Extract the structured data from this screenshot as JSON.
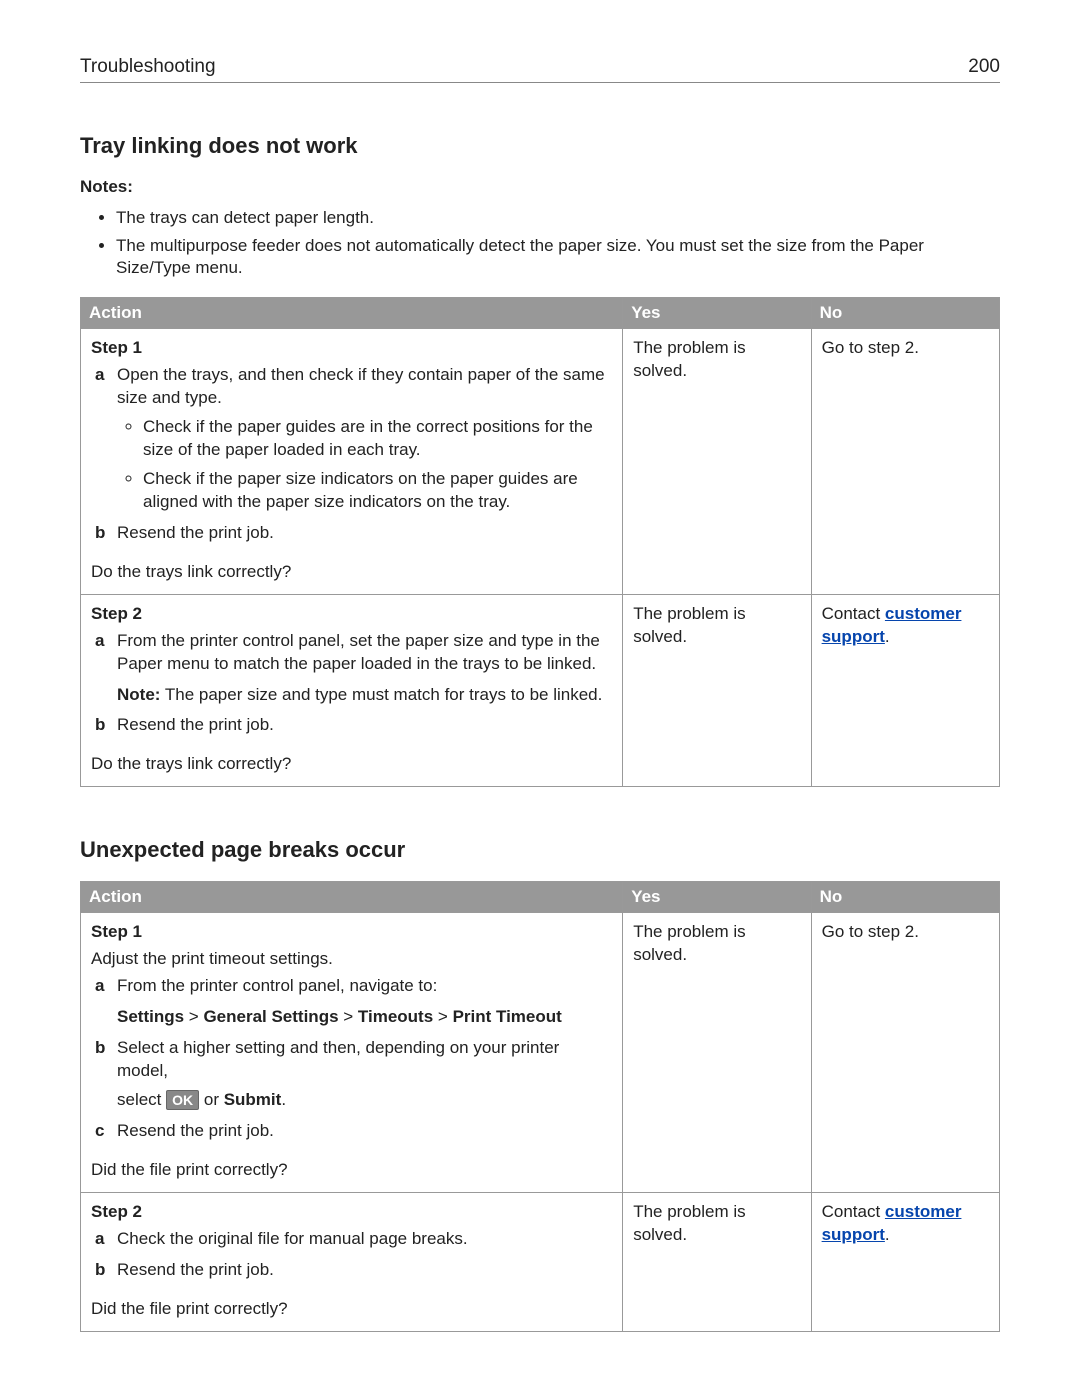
{
  "header": {
    "section": "Troubleshooting",
    "page": "200"
  },
  "sec1": {
    "heading": "Tray linking does not work",
    "notes_label": "Notes:",
    "bullets": [
      "The trays can detect paper length.",
      "The multipurpose feeder does not automatically detect the paper size. You must set the size from the Paper Size/Type menu."
    ],
    "table": {
      "cols": {
        "action": "Action",
        "yes": "Yes",
        "no": "No"
      },
      "rows": [
        {
          "step": "Step 1",
          "a": "Open the trays, and then check if they contain paper of the same size and type.",
          "a_bullets": [
            "Check if the paper guides are in the correct positions for the size of the paper loaded in each tray.",
            "Check if the paper size indicators on the paper guides are aligned with the paper size indicators on the tray."
          ],
          "b": "Resend the print job.",
          "question": "Do the trays link correctly?",
          "yes": "The problem is solved.",
          "no": "Go to step 2."
        },
        {
          "step": "Step 2",
          "a": "From the printer control panel, set the paper size and type in the Paper menu to match the paper loaded in the trays to be linked.",
          "note_label": "Note:",
          "note_text": " The paper size and type must match for trays to be linked.",
          "b": "Resend the print job.",
          "question": "Do the trays link correctly?",
          "yes": "The problem is solved.",
          "no_pre": "Contact ",
          "no_link": "customer support",
          "no_post": "."
        }
      ]
    }
  },
  "sec2": {
    "heading": "Unexpected page breaks occur",
    "table": {
      "cols": {
        "action": "Action",
        "yes": "Yes",
        "no": "No"
      },
      "rows": [
        {
          "step": "Step 1",
          "intro": "Adjust the print timeout settings.",
          "a": "From the printer control panel, navigate to:",
          "path": {
            "p1": "Settings",
            "gt1": " > ",
            "p2": "General Settings",
            "gt2": " > ",
            "p3": "Timeouts",
            "gt3": " > ",
            "p4": "Print Timeout"
          },
          "b": "Select a higher setting and then, depending on your printer model,",
          "b2_pre": "select ",
          "ok": "OK",
          "b2_mid": " or ",
          "b2_bold": "Submit",
          "b2_post": ".",
          "c": "Resend the print job.",
          "question": "Did the file print correctly?",
          "yes": "The problem is solved.",
          "no": "Go to step 2."
        },
        {
          "step": "Step 2",
          "a": "Check the original file for manual page breaks.",
          "b": "Resend the print job.",
          "question": "Did the file print correctly?",
          "yes": "The problem is solved.",
          "no_pre": "Contact ",
          "no_link": "customer support",
          "no_post": "."
        }
      ]
    }
  }
}
